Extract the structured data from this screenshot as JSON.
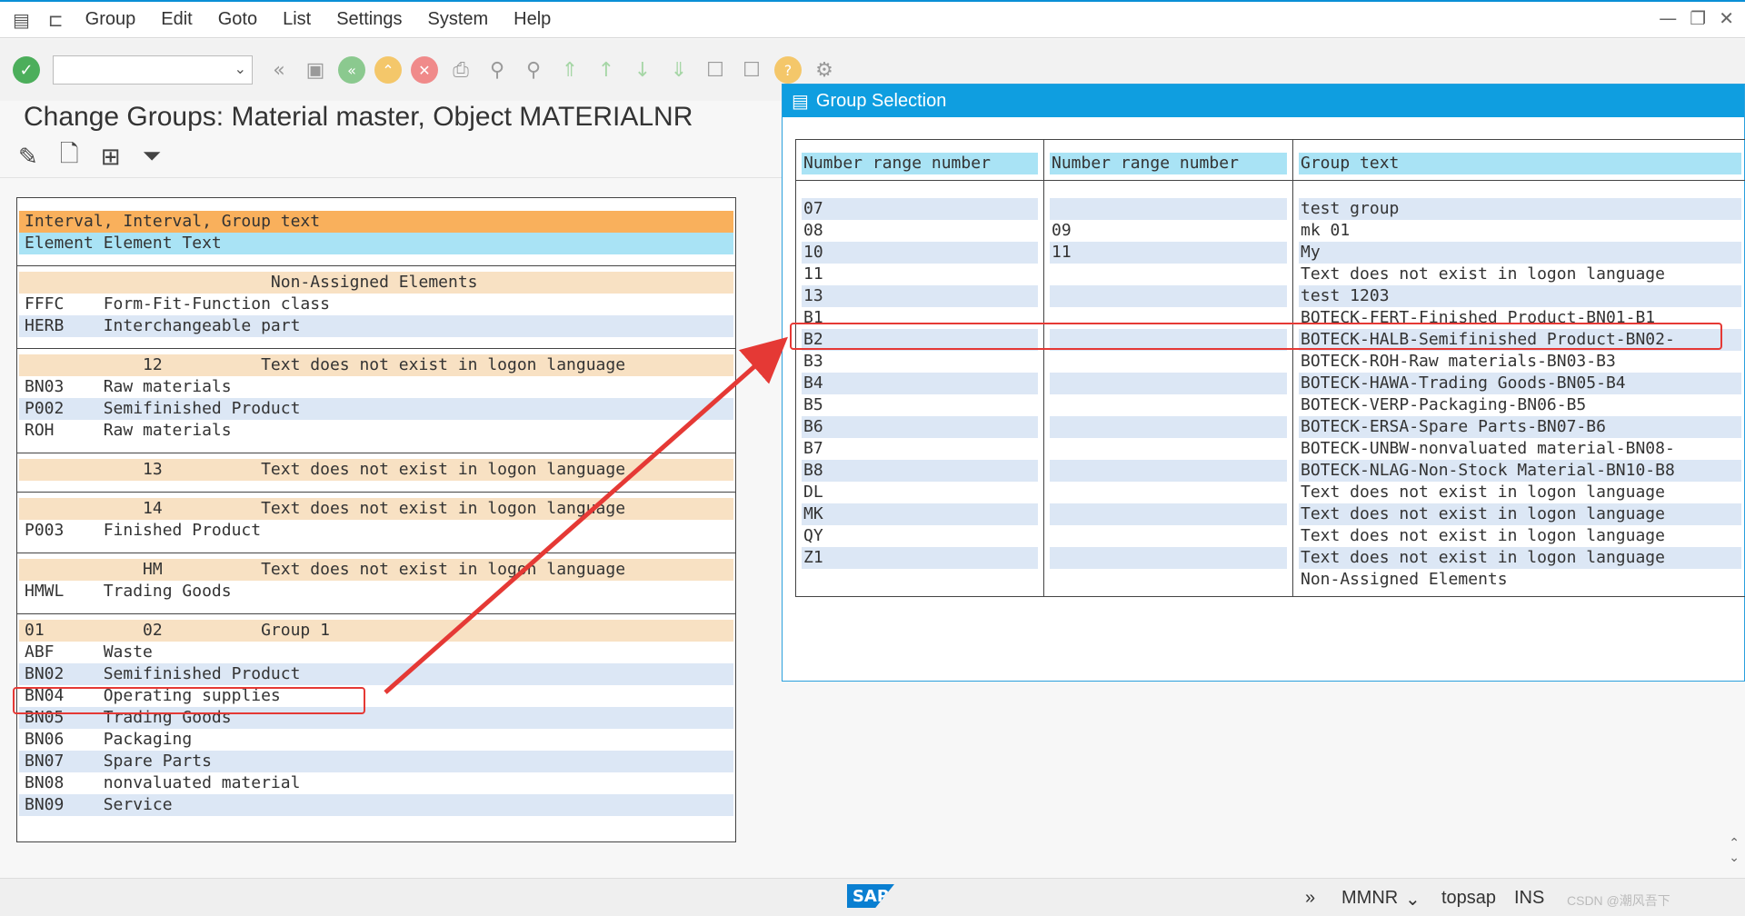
{
  "menu": [
    "Group",
    "Edit",
    "Goto",
    "List",
    "Settings",
    "System",
    "Help"
  ],
  "window_controls": [
    "—",
    "❐",
    "✕"
  ],
  "page_title": "Change Groups: Material master, Object MATERIALNR",
  "left_list": {
    "header1": "Interval, Interval, Group text",
    "header2": "Element Element Text",
    "groups": [
      {
        "head": "                         Non-Assigned Elements",
        "rows": [
          {
            "text": "FFFC    Form-Fit-Function class",
            "alt": false
          },
          {
            "text": "HERB    Interchangeable part",
            "alt": true
          }
        ]
      },
      {
        "head": "            12          Text does not exist in logon language",
        "rows": [
          {
            "text": "BN03    Raw materials",
            "alt": false
          },
          {
            "text": "P002    Semifinished Product",
            "alt": true
          },
          {
            "text": "ROH     Raw materials",
            "alt": false
          }
        ]
      },
      {
        "head": "            13          Text does not exist in logon language",
        "rows": []
      },
      {
        "head": "            14          Text does not exist in logon language",
        "rows": [
          {
            "text": "P003    Finished Product",
            "alt": false
          }
        ]
      },
      {
        "head": "            HM          Text does not exist in logon language",
        "rows": [
          {
            "text": "HMWL    Trading Goods",
            "alt": false
          }
        ]
      },
      {
        "head": "01          02          Group 1",
        "rows": [
          {
            "text": "ABF     Waste",
            "alt": false
          },
          {
            "text": "BN02    Semifinished Product",
            "alt": true
          },
          {
            "text": "BN04    Operating supplies",
            "alt": false
          },
          {
            "text": "BN05    Trading Goods",
            "alt": true
          },
          {
            "text": "BN06    Packaging",
            "alt": false
          },
          {
            "text": "BN07    Spare Parts",
            "alt": true
          },
          {
            "text": "BN08    nonvaluated material",
            "alt": false
          },
          {
            "text": "BN09    Service",
            "alt": true
          }
        ]
      }
    ]
  },
  "popup": {
    "title": "Group Selection",
    "columns": [
      "Number range number",
      "Number range number",
      "Group text"
    ],
    "rows": [
      {
        "a": "07",
        "b": "",
        "c": "test group"
      },
      {
        "a": "08",
        "b": "09",
        "c": "mk 01"
      },
      {
        "a": "10",
        "b": "11",
        "c": "My"
      },
      {
        "a": "11",
        "b": "",
        "c": "Text does not exist in logon language"
      },
      {
        "a": "13",
        "b": "",
        "c": "test 1203"
      },
      {
        "a": "B1",
        "b": "",
        "c": "BOTECK-FERT-Finished Product-BN01-B1"
      },
      {
        "a": "B2",
        "b": "",
        "c": "BOTECK-HALB-Semifinished Product-BN02-"
      },
      {
        "a": "B3",
        "b": "",
        "c": "BOTECK-ROH-Raw materials-BN03-B3"
      },
      {
        "a": "B4",
        "b": "",
        "c": "BOTECK-HAWA-Trading Goods-BN05-B4"
      },
      {
        "a": "B5",
        "b": "",
        "c": "BOTECK-VERP-Packaging-BN06-B5"
      },
      {
        "a": "B6",
        "b": "",
        "c": "BOTECK-ERSA-Spare Parts-BN07-B6"
      },
      {
        "a": "B7",
        "b": "",
        "c": "BOTECK-UNBW-nonvaluated material-BN08-"
      },
      {
        "a": "B8",
        "b": "",
        "c": "BOTECK-NLAG-Non-Stock Material-BN10-B8"
      },
      {
        "a": "DL",
        "b": "",
        "c": "Text does not exist in logon language"
      },
      {
        "a": "MK",
        "b": "",
        "c": "Text does not exist in logon language"
      },
      {
        "a": "QY",
        "b": "",
        "c": "Text does not exist in logon language"
      },
      {
        "a": "Z1",
        "b": "",
        "c": "Text does not exist in logon language"
      },
      {
        "a": "",
        "b": "",
        "c": "Non-Assigned Elements"
      }
    ]
  },
  "status": {
    "system": "MMNR",
    "client": "topsap",
    "mode": "INS",
    "watermark": "CSDN @潮风吾下",
    "sap_logo": "SAP"
  },
  "colors": {
    "header_orange": "#f9b05c",
    "header_blue": "#a9e3f5",
    "group_bg": "#f8e1c3",
    "alt_row": "#dce7f5",
    "popup_title": "#0f9ee0",
    "highlight_red": "#e53935"
  }
}
